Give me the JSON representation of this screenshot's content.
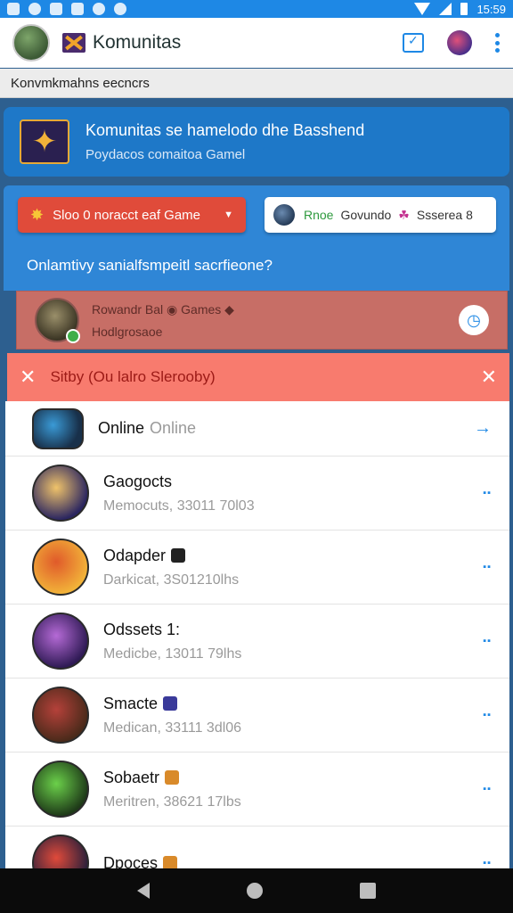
{
  "status_bar": {
    "time": "15:59"
  },
  "app_bar": {
    "title": "Komunitas"
  },
  "subheader": {
    "text": "Konvmkmahns eecncrs"
  },
  "banner": {
    "title": "Komunitas se hamelodo dhe Basshend",
    "subtitle": "Poydacos comaitoa Gamel"
  },
  "panel": {
    "red_button_label": "Sloo 0 noracct eaf Game",
    "white_button": {
      "part1": "Rnoe",
      "part2": "Govundo",
      "part3": "☘",
      "part4": "Ssserea 8"
    },
    "question": "Onlamtivy sanialfsmpeitl sacrfieone?"
  },
  "highlight": {
    "title": "Rowandr Bal ◉ Games ◆",
    "subtitle": "Hodlgrosaoe"
  },
  "error_bar": {
    "text": "Sitby (Ou lalro Slerooby)"
  },
  "list": {
    "first": {
      "name": "Online",
      "status": "Online"
    },
    "items": [
      {
        "name": "Gaogocts",
        "sub": "Memocuts, 33011 70l03",
        "badge_color": "",
        "avatar": [
          "#f0c36a",
          "#2a2560"
        ]
      },
      {
        "name": "Odapder",
        "sub": "Darkicat, 3S01210lhs",
        "badge_color": "#222222",
        "avatar": [
          "#e05a2a",
          "#f2b339"
        ]
      },
      {
        "name": "Odssets 1:",
        "sub": "Medicbe, 13011 79lhs",
        "badge_color": "",
        "avatar": [
          "#b56ad6",
          "#2f1a55"
        ]
      },
      {
        "name": "Smacte",
        "sub": "Medican, 33111 3dl06",
        "badge_color": "#3a3a9a",
        "avatar": [
          "#b5413a",
          "#4a2a1a"
        ]
      },
      {
        "name": "Sobaetr",
        "sub": "Meritren, 38621 17lbs",
        "badge_color": "#d98a2a",
        "avatar": [
          "#6bd04a",
          "#1e3a18"
        ]
      },
      {
        "name": "Dpoces",
        "sub": "",
        "badge_color": "#d98a2a",
        "avatar": [
          "#e04a3a",
          "#2a1f3a"
        ]
      }
    ]
  },
  "colors": {
    "accent": "#1e88e5",
    "error": "#f87b6e",
    "highlight": "#c76e66"
  }
}
